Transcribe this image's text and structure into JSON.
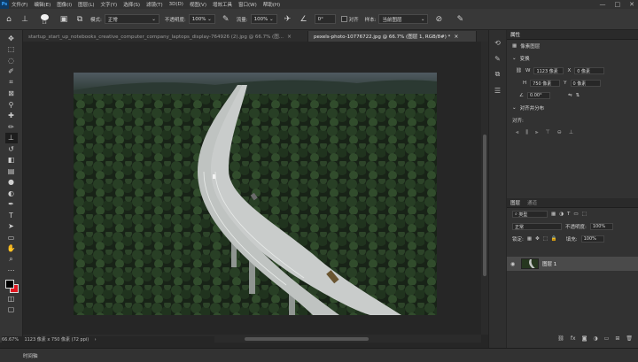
{
  "app": {
    "logo": "Ps"
  },
  "menu": [
    "文件(F)",
    "编辑(E)",
    "图像(I)",
    "图层(L)",
    "文字(Y)",
    "选择(S)",
    "滤镜(T)",
    "3D(D)",
    "视图(V)",
    "增效工具",
    "窗口(W)",
    "帮助(H)"
  ],
  "window_controls": [
    "—",
    "□",
    "✕"
  ],
  "options": {
    "brush_size": "13",
    "mode_label": "模式:",
    "mode_value": "正常",
    "opacity_label": "不透明度:",
    "opacity_value": "100%",
    "flow_label": "流量:",
    "flow_value": "100%",
    "angle_value": "0°",
    "align_label": "对齐",
    "sample_label": "样本:",
    "sample_value": "当前图层"
  },
  "tabs": [
    {
      "label": "startup_start_up_notebooks_creative_computer_company_laptops_display-764926 (2).jpg @ 66.7% (图...",
      "close": "×",
      "active": false
    },
    {
      "label": "pexels-photo-10776722.jpg @ 66.7% (图层 1, RGB/8#) *",
      "close": "×",
      "active": true
    }
  ],
  "status": {
    "zoom": "66.67%",
    "dimensions": "1123 像素 x 750 像素 (72 ppi)",
    "arrow": "›"
  },
  "timeline": {
    "label": "时间轴"
  },
  "properties": {
    "tabs": [
      "属性"
    ],
    "layer_kind": "像素图层",
    "transform_title": "变换",
    "w_label": "W",
    "w_value": "1123 像素",
    "h_label": "H",
    "h_value": "750 像素",
    "x_label": "X",
    "x_value": "0 像素",
    "y_label": "Y",
    "y_value": "0 像素",
    "angle": "0.00°",
    "align_title": "对齐并分布",
    "align_sub": "对齐:"
  },
  "layers": {
    "tabs": [
      "图层",
      "通道"
    ],
    "filter_label": "类型",
    "blend_mode": "正常",
    "opacity_label": "不透明度:",
    "opacity_value": "100%",
    "lock_label": "锁定:",
    "fill_label": "填充:",
    "fill_value": "100%",
    "layer_name": "图层 1",
    "footer_icons": [
      "link-icon",
      "fx-icon",
      "mask-icon",
      "adjust-icon",
      "group-icon",
      "new-layer-icon",
      "trash-icon"
    ]
  },
  "colors": {
    "foreground": "#000000",
    "background": "#e0141e",
    "accent": "#38a3ff"
  }
}
